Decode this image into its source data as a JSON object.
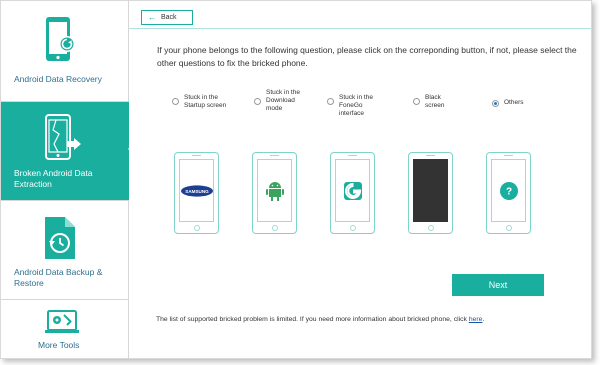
{
  "sidebar": {
    "items": [
      {
        "label": "Android Data Recovery",
        "active": false
      },
      {
        "label": "Broken Android Data Extraction",
        "active": true
      },
      {
        "label": "Android Data Backup & Restore",
        "active": false
      },
      {
        "label": "More Tools",
        "active": false
      }
    ]
  },
  "header": {
    "back_label": "Back"
  },
  "main": {
    "intro": "If your phone belongs to the following question, please click on the correponding button, if not, please select the other questions to fix the bricked phone.",
    "options": [
      {
        "label": "Stuck in the Startup screen",
        "checked": false
      },
      {
        "label": "Stuck in the Download mode",
        "checked": false
      },
      {
        "label": "Stuck in the FoneGo interface",
        "checked": false
      },
      {
        "label": "Black screen",
        "checked": false
      },
      {
        "label": "Others",
        "checked": true
      }
    ],
    "phones": [
      {
        "screen": "samsung-logo",
        "text": "SAMSUNG"
      },
      {
        "screen": "android-robot-icon",
        "text": ""
      },
      {
        "screen": "fonego-logo",
        "text": ""
      },
      {
        "screen": "black-screen",
        "text": ""
      },
      {
        "screen": "question-icon",
        "text": "?"
      }
    ],
    "next_label": "Next",
    "footer_text": "The list of supported bricked problem is limited. If you need more information about bricked phone, click ",
    "footer_link": "here",
    "footer_end": "."
  },
  "colors": {
    "accent": "#1aae9f",
    "sidebar_text": "#2f6f8f",
    "link": "#1a56b0",
    "samsung_blue": "#1c3f94",
    "android_green": "#3aa35e"
  }
}
